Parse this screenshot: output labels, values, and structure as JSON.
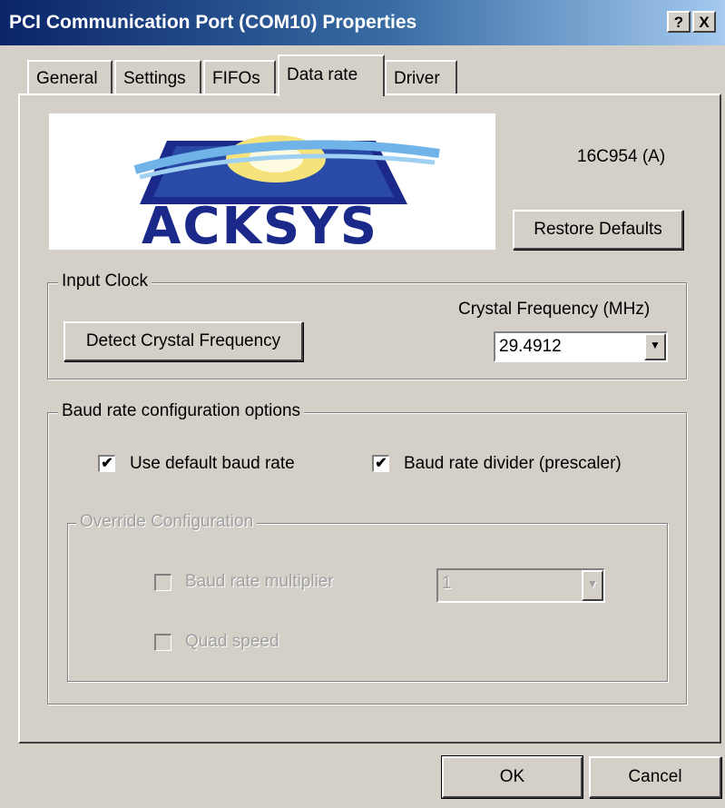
{
  "window": {
    "title": "PCI Communication Port (COM10) Properties",
    "help_button": "?",
    "close_button": "X"
  },
  "tabs": [
    {
      "label": "General"
    },
    {
      "label": "Settings"
    },
    {
      "label": "FIFOs"
    },
    {
      "label": "Data rate"
    },
    {
      "label": "Driver"
    }
  ],
  "active_tab": "Data rate",
  "logo": {
    "text": "ACKSYS"
  },
  "chip": {
    "label": "16C954 (A)"
  },
  "restore_defaults_button": "Restore Defaults",
  "input_clock": {
    "legend": "Input Clock",
    "detect_button": "Detect Crystal Frequency",
    "crystal_label": "Crystal Frequency (MHz)",
    "crystal_value": "29.4912"
  },
  "baud_options": {
    "legend": "Baud rate configuration options",
    "use_default": {
      "label": "Use default baud rate",
      "checked": true
    },
    "divider": {
      "label": "Baud rate divider (prescaler)",
      "checked": true
    }
  },
  "override": {
    "legend": "Override Configuration",
    "multiplier": {
      "label": "Baud rate multiplier",
      "checked": false
    },
    "multiplier_value": "1",
    "quad_speed": {
      "label": "Quad speed",
      "checked": false
    }
  },
  "footer": {
    "ok_button": "OK",
    "cancel_button": "Cancel"
  }
}
